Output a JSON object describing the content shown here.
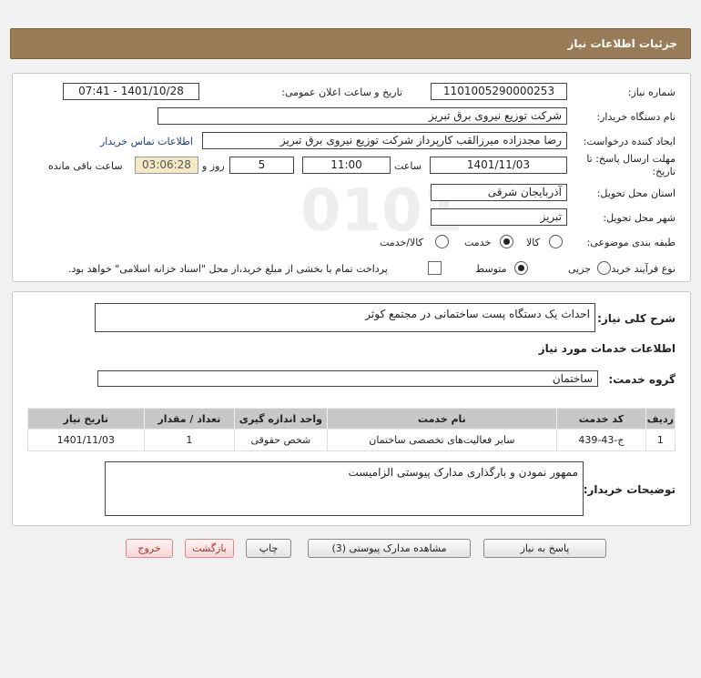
{
  "header": {
    "title": "جزئیات اطلاعات نیاز"
  },
  "details": {
    "need_number_label": "شماره نیاز:",
    "need_number": "1101005290000253",
    "announce_label": "تاریخ و ساعت اعلان عمومی:",
    "announce_value": "1401/10/28 - 07:41",
    "buyer_org_label": "نام دستگاه خریدار:",
    "buyer_org": "شرکت توزیع نیروی برق تبریز",
    "requester_label": "ایجاد کننده درخواست:",
    "requester": "رضا مجدزاده میرزالقب کارپرداز شرکت توزیع نیروی برق تبریز",
    "contact_link": "اطلاعات تماس خریدار",
    "deadline_label_line1": "مهلت ارسال پاسخ: تا",
    "deadline_label_line2": "تاریخ:",
    "deadline_date": "1401/11/03",
    "time_label": "ساعت",
    "deadline_time": "11:00",
    "days_value": "5",
    "days_label": "روز و",
    "remaining_time": "03:06:28",
    "remaining_label": "ساعت باقی مانده",
    "province_label": "استان محل تحویل:",
    "province": "آذربایجان شرقی",
    "city_label": "شهر محل تحویل:",
    "city": "تبریز",
    "category_label": "طبقه بندی موضوعی:",
    "category_options": [
      "کالا",
      "خدمت",
      "کالا/خدمت"
    ],
    "category_selected": "خدمت",
    "process_label": "نوع فرآیند خرید :",
    "process_options": [
      "جزیی",
      "متوسط"
    ],
    "process_selected": "متوسط",
    "payment_text": "پرداخت تمام یا بخشی از مبلغ خرید،از محل \"اسناد خزانه اسلامی\" خواهد بود."
  },
  "summary": {
    "label": "شرح کلی نیاز:",
    "value": "احداث یک دستگاه پست ساختمانی در مجتمع کوثر"
  },
  "services": {
    "section_title": "اطلاعات خدمات مورد نیاز",
    "group_label": "گروه خدمت:",
    "group_value": "ساختمان",
    "columns": [
      "ردیف",
      "کد خدمت",
      "نام خدمت",
      "واحد اندازه گیری",
      "تعداد / مقدار",
      "تاریخ نیاز"
    ],
    "rows": [
      [
        "1",
        "ج-43-439",
        "سایر فعالیت‌های تخصصی ساختمان",
        "شخص حقوقی",
        "1",
        "1401/11/03"
      ]
    ]
  },
  "buyer_notes": {
    "label": "توضیحات خریدار:",
    "value": "ممهور نمودن و بارگذاری مدارک پیوستی الزامیست"
  },
  "buttons": {
    "reply": "پاسخ به نیاز",
    "attachments": "مشاهده مدارک پیوستی (3)",
    "print": "چاپ",
    "back": "بازگشت",
    "exit": "خروج"
  }
}
